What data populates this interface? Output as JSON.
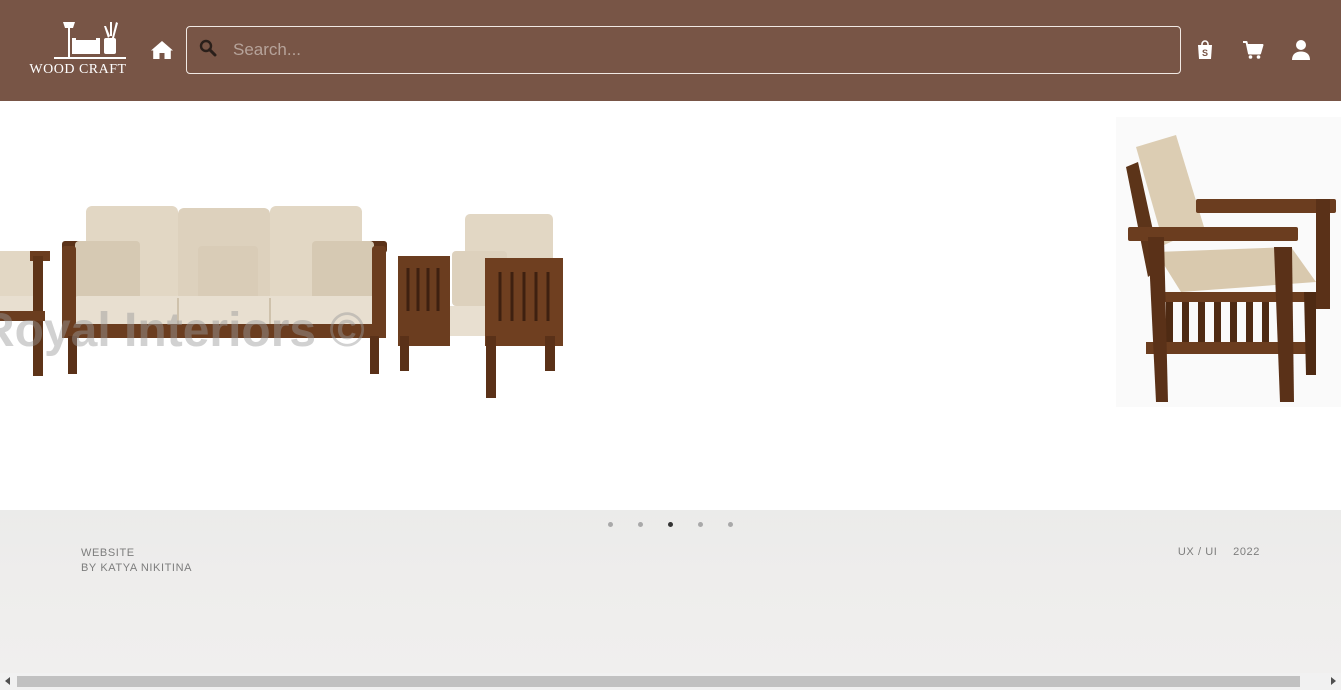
{
  "brand": {
    "name": "WOOD CRAFT"
  },
  "header": {
    "search_placeholder": "Search...",
    "icons": [
      "home-icon",
      "search-icon",
      "shopping-bag-icon",
      "cart-icon",
      "user-icon"
    ]
  },
  "carousel": {
    "slide_count": 5,
    "active_index": 2,
    "slides": [
      {
        "name": "wooden-sofa-set-image",
        "watermark": "Royal Interiors ©"
      },
      {
        "name": "wooden-armchair-image"
      }
    ]
  },
  "footer": {
    "credit_line1": "WEBSITE",
    "credit_line2": "BY KATYA NIKITINA",
    "category": "UX / UI",
    "year": "2022"
  },
  "colors": {
    "header_bg": "#785546",
    "cushion": "#e2d7c4",
    "wood": "#6b3d1f",
    "footer_bg": "#ececeb"
  }
}
